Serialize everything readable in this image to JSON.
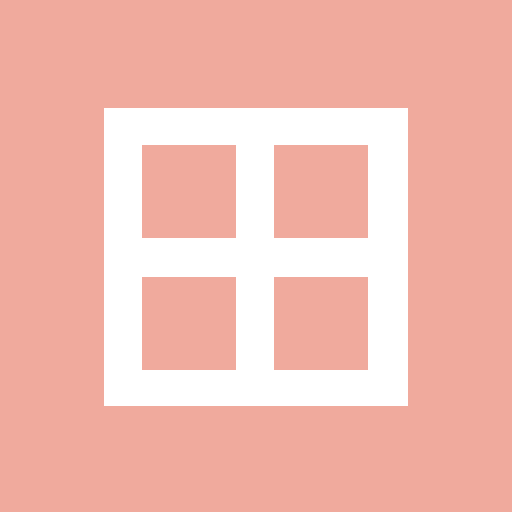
{
  "icon": {
    "name": "grid-icon",
    "colors": {
      "background": "#f0aa9d",
      "foreground": "#ffffff"
    }
  }
}
